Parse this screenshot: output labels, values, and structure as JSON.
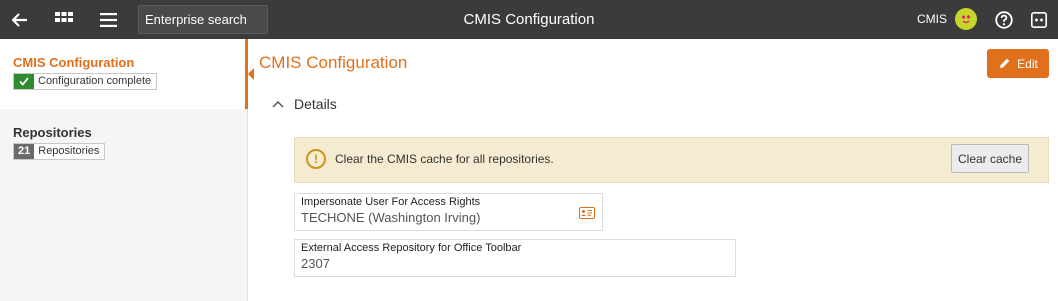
{
  "header": {
    "search_label": "Enterprise search",
    "title": "CMIS Configuration",
    "user_name": "CMIS",
    "icons": [
      "back-arrow-icon",
      "apps-grid-icon",
      "hamburger-menu-icon",
      "avatar",
      "help-icon",
      "extensions-icon"
    ]
  },
  "sidebar": {
    "items": [
      {
        "title": "CMIS Configuration",
        "badge_text": "Configuration complete",
        "badge_icon": "check-icon",
        "active": true
      },
      {
        "title": "Repositories",
        "badge_count": "21",
        "badge_text": "Repositories",
        "active": false
      }
    ]
  },
  "main": {
    "title": "CMIS Configuration",
    "edit_label": "Edit",
    "section_title": "Details",
    "notice": {
      "message": "Clear the CMIS cache for all repositories.",
      "button_label": "Clear cache"
    },
    "fields": [
      {
        "label": "Impersonate User For Access Rights",
        "value": "TECHONE (Washington Irving)"
      },
      {
        "label": "External Access Repository for Office Toolbar",
        "value": "2307"
      }
    ]
  },
  "colors": {
    "accent": "#e0701b",
    "topbar": "#3b3b3d",
    "success": "#2e8b2e",
    "notice_bg": "#f5ebd1"
  }
}
